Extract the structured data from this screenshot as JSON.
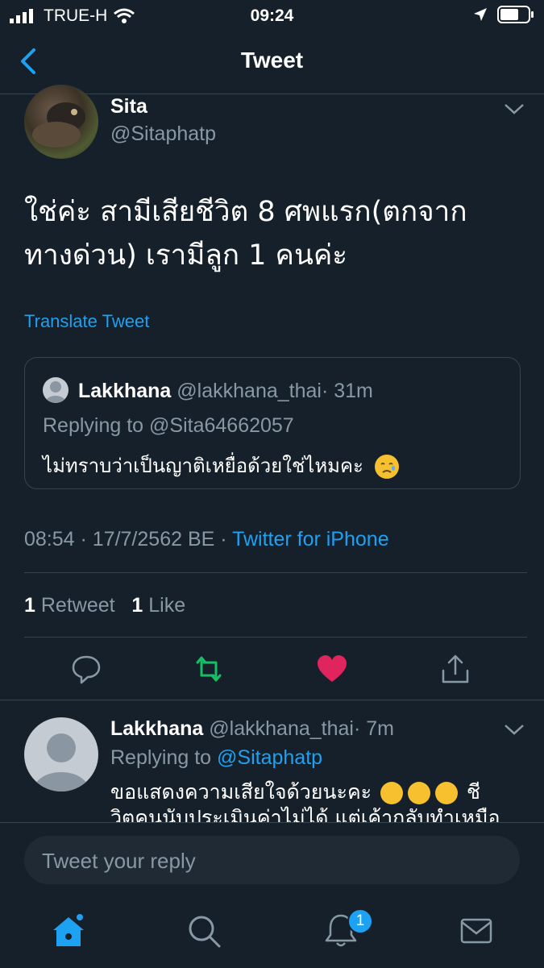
{
  "status_bar": {
    "carrier": "TRUE-H",
    "time": "09:24"
  },
  "nav": {
    "title": "Tweet"
  },
  "tweet": {
    "author_name": "Sita",
    "author_handle": "@Sitaphatp",
    "text": "ใช่ค่ะ สามีเสียชีวิต 8 ศพแรก(ตกจากทางด่วน) เรามีลูก 1 คนค่ะ",
    "translate_label": "Translate Tweet",
    "quoted": {
      "author_name": "Lakkhana",
      "author_handle": "@lakkhana_thai",
      "age": "· 31m",
      "replying_to": "Replying to @Sita64662057",
      "text": "ไม่ทราบว่าเป็นญาติเหยื่อด้วยใช่ไหมคะ",
      "emoji": "disappointed-relieved-face"
    },
    "timestamp": "08:54 · 17/7/2562 BE ·",
    "source": "Twitter for iPhone",
    "retweet_count": "1",
    "retweet_label": "Retweet",
    "like_count": "1",
    "like_label": "Like",
    "liked": true,
    "colors": {
      "accent": "#1da1f2",
      "retweet": "#17bf63",
      "like": "#e0245e"
    }
  },
  "reply": {
    "author_name": "Lakkhana",
    "author_handle": "@lakkhana_thai",
    "age": "· 7m",
    "replying_prefix": "Replying to",
    "replying_user": "@Sitaphatp",
    "text_line1": "ขอแสดงความเสียใจด้วยนะคะ",
    "text_after_emoji": "ชี",
    "text_line2": "วิตคนนับประเมินค่าไม่ได้ แต่เค้ากลับทำเหมือ",
    "emoji": "loudly-crying-face"
  },
  "compose": {
    "placeholder": "Tweet your reply"
  },
  "tab_bar": {
    "items": [
      "home-icon",
      "search-icon",
      "notifications-icon",
      "messages-icon"
    ],
    "notification_badge": "1"
  }
}
